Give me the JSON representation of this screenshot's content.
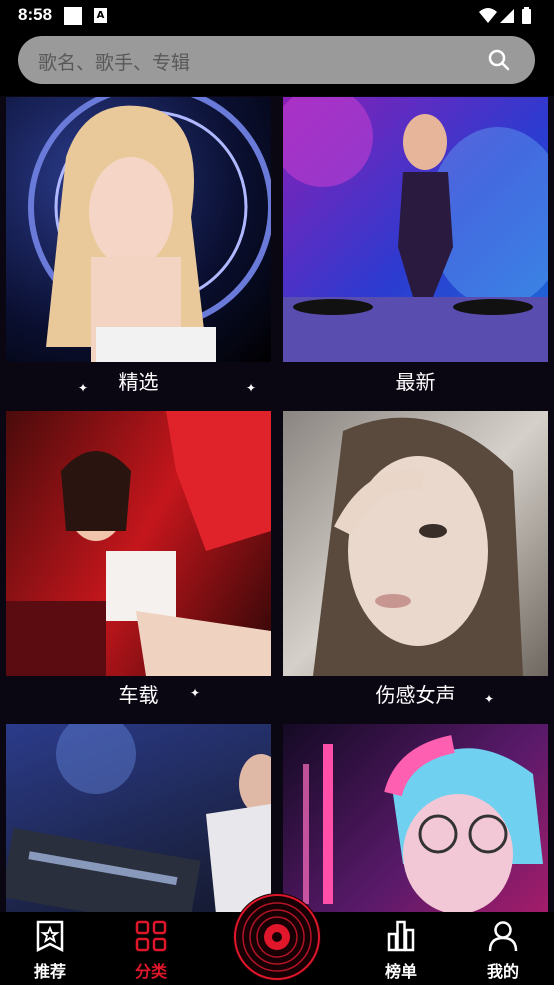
{
  "status": {
    "time": "8:58"
  },
  "search": {
    "placeholder": "歌名、歌手、专辑"
  },
  "categories": [
    {
      "label": "精选"
    },
    {
      "label": "最新"
    },
    {
      "label": "车载"
    },
    {
      "label": "伤感女声"
    },
    {
      "label": ""
    },
    {
      "label": ""
    }
  ],
  "nav": {
    "items": [
      {
        "label": "推荐",
        "icon": "star-bookmark-icon"
      },
      {
        "label": "分类",
        "icon": "grid-icon",
        "active": true
      },
      {
        "label": "",
        "icon": "vinyl-record-icon"
      },
      {
        "label": "榜单",
        "icon": "bar-chart-icon"
      },
      {
        "label": "我的",
        "icon": "person-icon"
      }
    ]
  },
  "colors": {
    "accent": "#e0162b",
    "background": "#000000",
    "search_bg": "#9a9a9a"
  }
}
